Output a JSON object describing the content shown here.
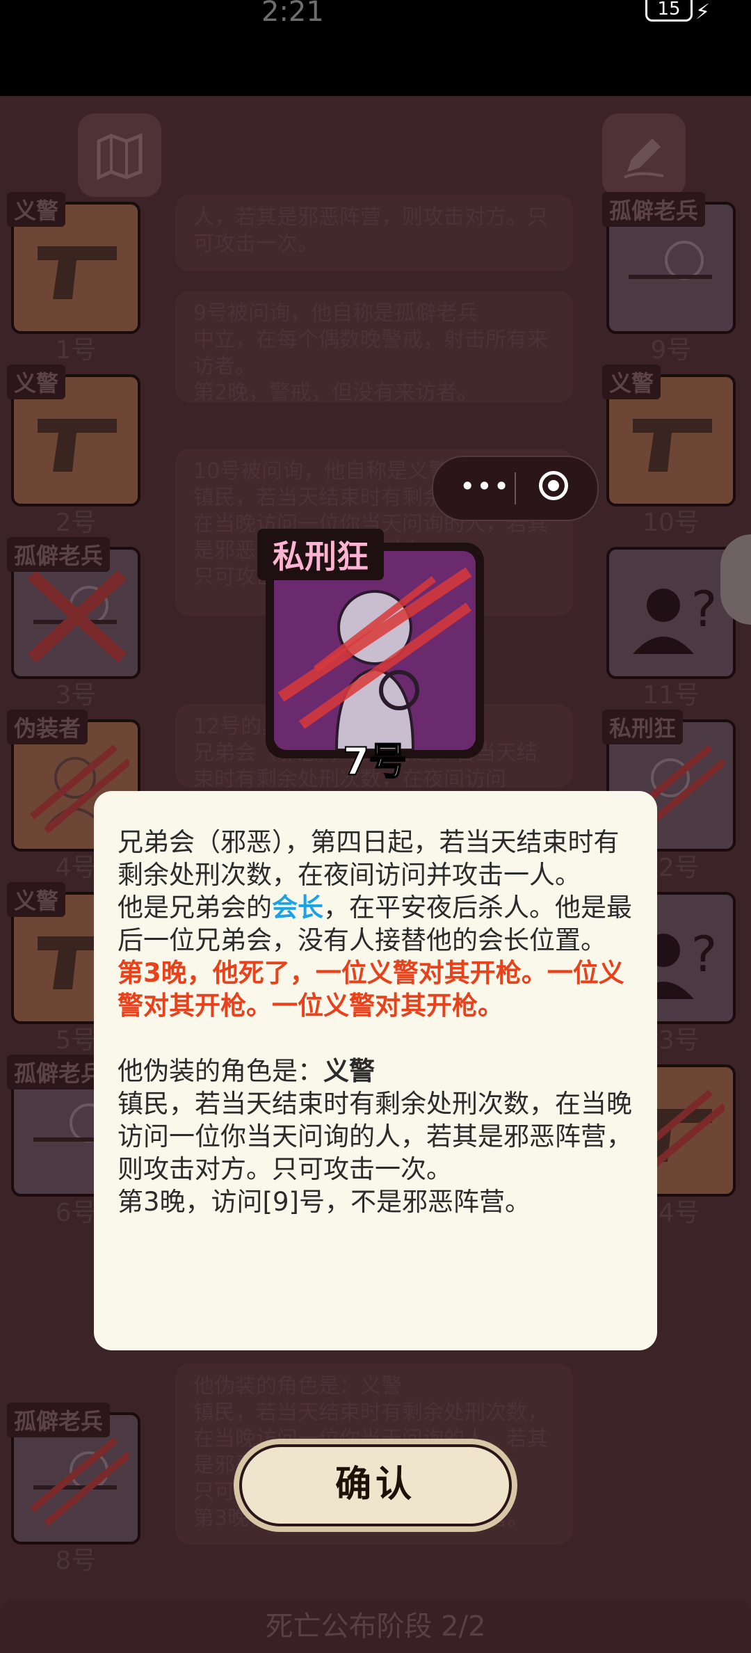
{
  "status_bar": {
    "time": "2:21",
    "battery": "15"
  },
  "players_left": [
    {
      "role": "义警",
      "number": "1号",
      "icon": "gun-icon",
      "dead": false
    },
    {
      "role": "义警",
      "number": "2号",
      "icon": "gun-icon",
      "dead": false
    },
    {
      "role": "孤僻老兵",
      "number": "3号",
      "icon": "veteran-icon",
      "dead": true
    },
    {
      "role": "伪装者",
      "number": "4号",
      "icon": "disguiser-icon",
      "dead": true
    },
    {
      "role": "义警",
      "number": "5号",
      "icon": "gun-icon",
      "dead": false
    },
    {
      "role": "孤僻老兵",
      "number": "6号",
      "icon": "veteran-icon",
      "dead": false
    },
    {
      "role": "孤僻老兵",
      "number": "8号",
      "icon": "veteran-icon",
      "dead": true
    }
  ],
  "players_right": [
    {
      "role": "孤僻老兵",
      "number": "9号",
      "icon": "veteran-icon",
      "dead": false
    },
    {
      "role": "义警",
      "number": "10号",
      "icon": "gun-icon",
      "dead": false
    },
    {
      "role": "",
      "number": "11号",
      "icon": "unknown-person-icon",
      "dead": false
    },
    {
      "role": "私刑狂",
      "number": "12号",
      "icon": "lyncher-icon",
      "dead": true
    },
    {
      "role": "",
      "number": "13号",
      "icon": "unknown-person-icon",
      "dead": false
    },
    {
      "role": "",
      "number": "14号",
      "icon": "gun-icon",
      "dead": true
    }
  ],
  "log_entries": [
    "人，若其是邪恶阵营，则攻击对方。只可攻击一次。",
    "9号被问询，他自称是孤僻老兵\n中立，在每个偶数晚警戒，射击所有来访者。\n第2晚，警戒，但没有来访者。",
    "10号被问询，他自称是义警\n镇民，若当天结束时有剩余处刑次数，在当晚访问一位你当天问询的人，若其是邪恶阵营，则攻击对方。\n只可攻击一次。",
    "12号的真实身份\n兄弟会（邪恶），第四日起，若当天结束时有剩余处刑次数，在夜间访问",
    "他伪装的角色是：义警\n镇民，若当天结束时有剩余处刑次数，在当晚访问一位你当天问询的人，若其是邪恶阵营，则攻击对方。\n只可攻击一次。\n第3晚，访问[9]号，不是邪恶阵营。"
  ],
  "role_card": {
    "role": "私刑狂",
    "number": "7号"
  },
  "dialog": {
    "line1": "兄弟会（邪恶），第四日起，若当天结束时有剩余处刑次数，在夜间访问并攻击一人。",
    "line2_pre": "他是兄弟会的",
    "line2_highlight": "会长",
    "line2_post": "，在平安夜后杀人。他是最后一位兄弟会，没有人接替他的会长位置。",
    "death_note": "第3晚，他死了，一位义警对其开枪。一位义警对其开枪。一位义警对其开枪。",
    "disguise_label": "他伪装的角色是：",
    "disguise_role": "义警",
    "disguise_desc": "镇民，若当天结束时有剩余处刑次数，在当晚访问一位你当天问询的人，若其是邪恶阵营，则攻击对方。只可攻击一次。",
    "visit_note": "第3晚，访问[9]号，不是邪恶阵营。"
  },
  "confirm_label": "确认",
  "phase": "死亡公布阶段 2/2",
  "colors": {
    "highlight_blue": "#1aa3e6",
    "death_red": "#e8411c",
    "dialog_bg": "#f9f8ea",
    "lyncher_purple": "#6b2a6e"
  }
}
